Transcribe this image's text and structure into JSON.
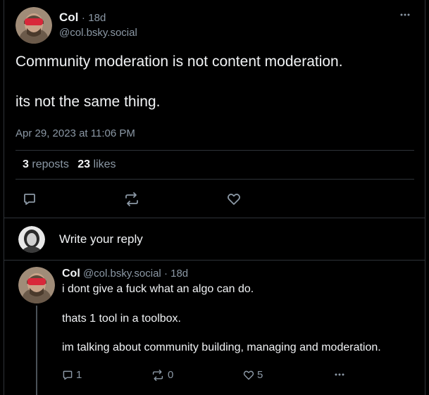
{
  "post": {
    "author_name": "Col",
    "separator": "·",
    "age": "18d",
    "handle": "@col.bsky.social",
    "text_line1": "Community moderation is not content moderation.",
    "text_line2": "its not the same thing.",
    "timestamp": "Apr 29, 2023 at 11:06 PM",
    "reposts_count": "3",
    "reposts_label": "reposts",
    "likes_count": "23",
    "likes_label": "likes"
  },
  "composer": {
    "placeholder": "Write your reply"
  },
  "reply": {
    "author_name": "Col",
    "handle": "@col.bsky.social",
    "separator": "·",
    "age": "18d",
    "line1": "i dont give a fuck what an algo can do.",
    "line2": "thats 1 tool in a toolbox.",
    "line3": "im talking about community building, managing and moderation.",
    "reply_count": "1",
    "repost_count": "0",
    "like_count": "5"
  },
  "colors": {
    "background": "#000000",
    "text": "#f1f3f5",
    "muted": "#8b98a5",
    "divider": "#2e3338"
  },
  "icons": [
    "more-icon",
    "reply-icon",
    "repost-icon",
    "like-icon"
  ]
}
